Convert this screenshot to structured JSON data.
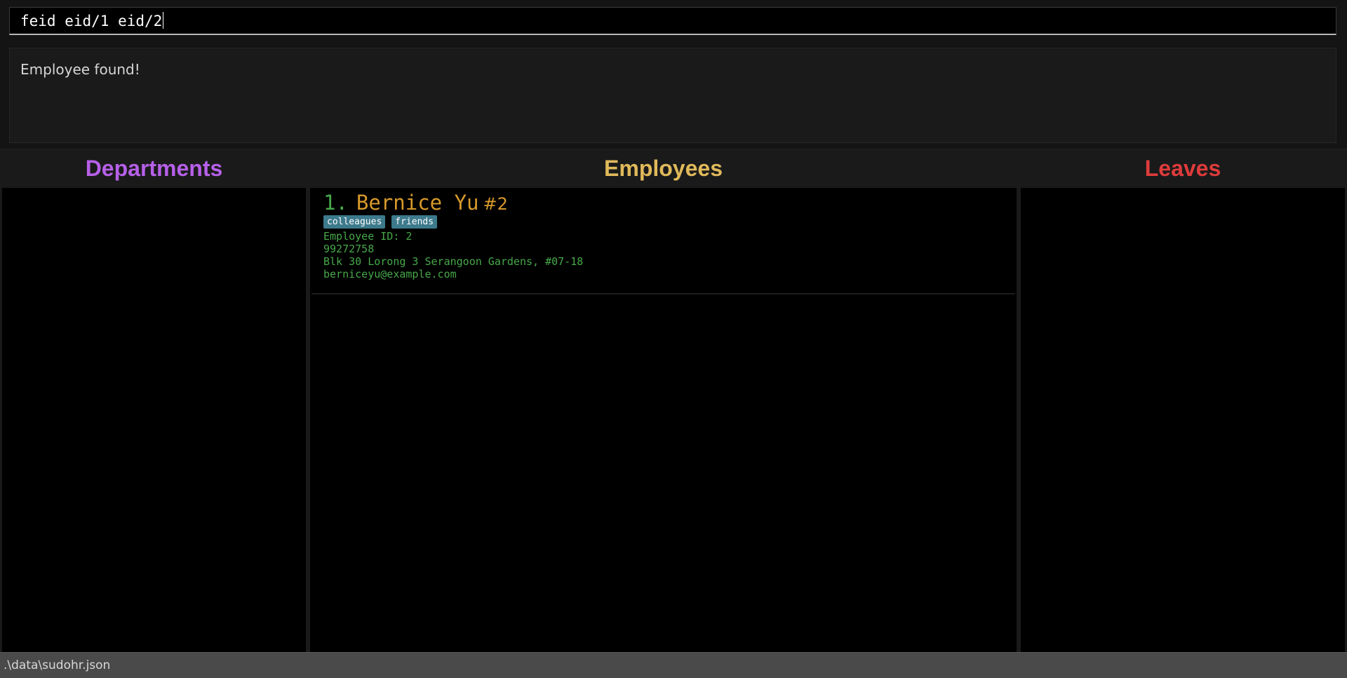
{
  "command": {
    "value": "feid eid/1 eid/2"
  },
  "result": {
    "text": "Employee found!"
  },
  "panels": {
    "departments": {
      "title": "Departments",
      "color": "#b660e8"
    },
    "employees": {
      "title": "Employees",
      "color": "#e0b95a"
    },
    "leaves": {
      "title": "Leaves",
      "color": "#de3b3b"
    }
  },
  "employees": [
    {
      "index": "1.",
      "name": "Bernice Yu",
      "hash": "#2",
      "tags": [
        "colleagues",
        "friends"
      ],
      "id_line": "Employee ID: 2",
      "phone": "99272758",
      "address": "Blk 30 Lorong 3 Serangoon Gardens, #07-18",
      "email": "berniceyu@example.com"
    }
  ],
  "status": {
    "path": ".\\data\\sudohr.json"
  }
}
